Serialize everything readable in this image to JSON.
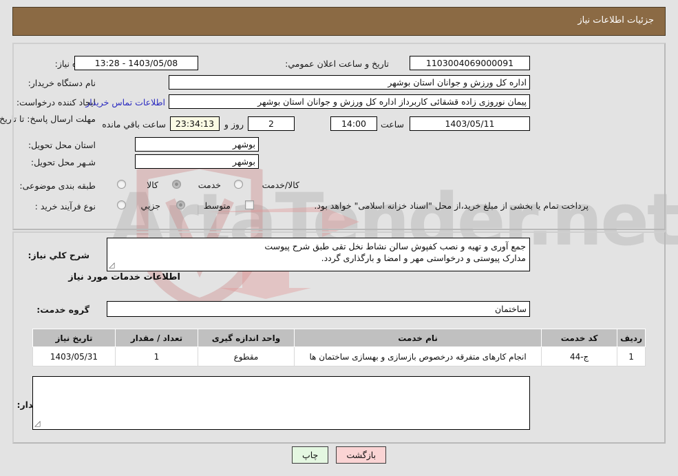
{
  "header": {
    "title": "جزئیات اطلاعات نیاز"
  },
  "colors": {
    "header_bg": "#8b6a44",
    "panel_bg": "#e3e3e3",
    "link": "#2b2bc0",
    "countdown_bg": "#fbfbe4",
    "back_btn_bg": "#fad4d4",
    "print_btn_bg": "#e4f7e1",
    "table_header_bg": "#c0c0c0"
  },
  "watermark": {
    "text": "ArtaTender.net"
  },
  "top_form": {
    "need_number_label": "شماره نیاز:",
    "need_number_value": "1103004069000091",
    "public_announce_label": "تاریخ و ساعت اعلان عمومي:",
    "public_announce_value": "1403/05/08 - 13:28",
    "buyer_org_label": "نام دستگاه خریدار:",
    "buyer_org_value": "اداره کل ورزش و جوانان استان بوشهر",
    "creator_label": "ایجاد کننده درخواست:",
    "creator_value": "پیمان نوروزی زاده قشقائی کاربرداز اداره کل ورزش و جوانان استان بوشهر",
    "contact_link": "اطلاعات تماس خریدار",
    "deadline_label": "مهلت ارسال پاسخ: تا تاریخ:",
    "deadline_date": "1403/05/11",
    "hour_label": "ساعت",
    "deadline_time": "14:00",
    "days_value": "2",
    "days_label": "روز و",
    "countdown_value": "23:34:13",
    "remaining_label": "ساعت باقي مانده",
    "province_label": "استان محل تحویل:",
    "province_value": "بوشهر",
    "city_label": "شـهر محل تحویل:",
    "city_value": "بوشهر",
    "category_label": "طبقه بندی موضوعی:",
    "category_options": [
      {
        "label": "کالا",
        "selected": false
      },
      {
        "label": "خدمت",
        "selected": true
      },
      {
        "label": "کالا/خدمت",
        "selected": false
      }
    ],
    "process_label": "نوع فرآیند خرید :",
    "process_options": [
      {
        "label": "جزیي",
        "selected": false
      },
      {
        "label": "متوسط",
        "selected": true
      }
    ],
    "treasury_checkbox_label": "پرداخت تمام یا بخشی از مبلغ خرید،از محل \"اسناد خزانه اسلامی\" خواهد بود.",
    "treasury_checked": false
  },
  "mid_form": {
    "summary_label": "شرح کلي نیاز:",
    "summary_value": "جمع آوری و تهیه و نصب کفپوش سالن نشاط نخل تقی طبق شرح پیوست\nمدارک پیوستی و درخواستی مهر و امضا و بارگذاری گردد.",
    "services_heading": "اطلاعات خدمات مورد نیاز",
    "service_group_label": "گروه خدمت:",
    "service_group_value": "ساختمان",
    "buyer_notes_label": "توضیحات خریدار:",
    "buyer_notes_value": ""
  },
  "table": {
    "columns": [
      "ردیف",
      "کد خدمت",
      "نام خدمت",
      "واحد اندازه گیری",
      "تعداد / مقدار",
      "تاریخ نیاز"
    ],
    "rows": [
      {
        "row_no": "1",
        "service_code": "ج-44",
        "service_name": "انجام کارهای متفرقه درخصوص بازسازی و بهسازی ساختمان ها",
        "unit": "مقطوع",
        "quantity": "1",
        "need_date": "1403/05/31"
      }
    ]
  },
  "buttons": {
    "print": "چاپ",
    "back": "بازگشت"
  }
}
